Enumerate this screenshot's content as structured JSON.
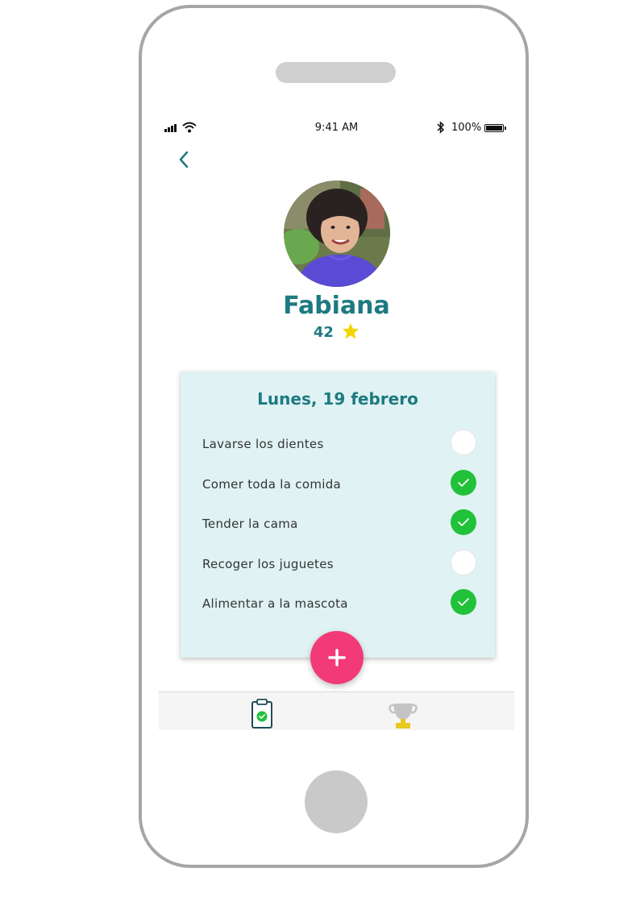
{
  "status_bar": {
    "time": "9:41 AM",
    "battery": "100%"
  },
  "header": {
    "back_icon": "chevron-left-icon"
  },
  "profile": {
    "name": "Fabiana",
    "points": "42",
    "points_icon": "star-icon"
  },
  "card": {
    "date": "Lunes, 19 febrero",
    "tasks": [
      {
        "label": "Lavarse los dientes",
        "done": false
      },
      {
        "label": "Comer toda la comida",
        "done": true
      },
      {
        "label": "Tender la cama",
        "done": true
      },
      {
        "label": "Recoger los juguetes",
        "done": false
      },
      {
        "label": "Alimentar a la mascota",
        "done": true
      }
    ]
  },
  "fab": {
    "icon": "plus-icon"
  },
  "tabs": [
    {
      "icon": "clipboard-check-icon",
      "active": true
    },
    {
      "icon": "trophy-icon",
      "active": false
    }
  ],
  "colors": {
    "accent": "#1d7a80",
    "card_bg": "#e0f2f3",
    "check_on": "#22c13a",
    "fab": "#f23a78",
    "star": "#f2d600"
  }
}
